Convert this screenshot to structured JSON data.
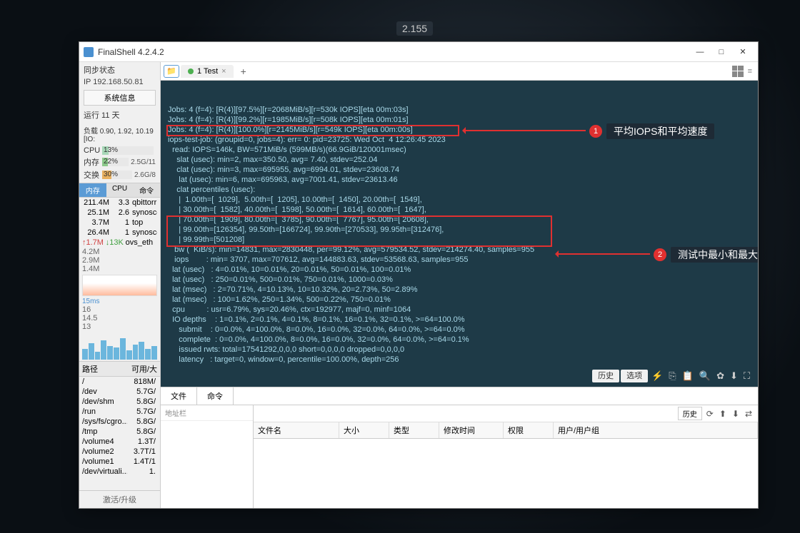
{
  "desktop": {
    "floating_number": "2.155"
  },
  "window": {
    "title": "FinalShell 4.2.4.2"
  },
  "sidebar": {
    "sync_label": "同步状态",
    "ip": "IP 192.168.50.81",
    "sysinfo_btn": "系统信息",
    "uptime": "运行 11 天",
    "load": "负载 0.90, 1.92, 10.19 [IO:",
    "cpu": {
      "label": "CPU",
      "pct": "13%",
      "fill": 13
    },
    "mem": {
      "label": "内存",
      "pct": "22%",
      "right": "2.5G/11",
      "fill": 22,
      "fillColor": "#8bc98b"
    },
    "swap": {
      "label": "交换",
      "pct": "30%",
      "right": "2.6G/8",
      "fill": 30,
      "fillColor": "#e8b060"
    },
    "proc_tabs": [
      "内存",
      "CPU",
      "命令"
    ],
    "procs": [
      {
        "c1": "211.4M",
        "c2": "3.3",
        "c3": "qbittorr"
      },
      {
        "c1": "25.1M",
        "c2": "2.6",
        "c3": "synoscg"
      },
      {
        "c1": "3.7M",
        "c2": "1",
        "c3": "top"
      },
      {
        "c1": "26.4M",
        "c2": "1",
        "c3": "synoscg"
      }
    ],
    "net": {
      "up": "↑1.7M",
      "dn": "↓13K",
      "iface": "ovs_eth"
    },
    "net_nums": [
      "4.2M",
      "2.9M",
      "1.4M"
    ],
    "ping": "15ms",
    "ping_nums": [
      "16",
      "14.5",
      "13"
    ],
    "fs_head": [
      "路径",
      "可用/大"
    ],
    "fs": [
      {
        "p": "/",
        "u": "818M/",
        "pct": 40
      },
      {
        "p": "/dev",
        "u": "5.7G/",
        "pct": 10
      },
      {
        "p": "/dev/shm",
        "u": "5.8G/",
        "pct": 10
      },
      {
        "p": "/run",
        "u": "5.7G/",
        "pct": 10
      },
      {
        "p": "/sys/fs/cgro...",
        "u": "5.8G/",
        "pct": 10
      },
      {
        "p": "/tmp",
        "u": "5.8G/",
        "pct": 10
      },
      {
        "p": "/volume4",
        "u": "1.3T/",
        "pct": 60,
        "warn": true
      },
      {
        "p": "/volume2",
        "u": "3.7T/1",
        "pct": 30
      },
      {
        "p": "/volume1",
        "u": "1.4T/1",
        "pct": 50
      },
      {
        "p": "/dev/virtuali...",
        "u": "1.",
        "pct": 5
      }
    ],
    "upgrade": "激活/升级"
  },
  "tabs": {
    "tab1": "1 Test"
  },
  "terminal_lines": [
    "Jobs: 4 (f=4): [R(4)][97.5%][r=2068MiB/s][r=530k IOPS][eta 00m:03s]",
    "Jobs: 4 (f=4): [R(4)][99.2%][r=1985MiB/s][r=508k IOPS][eta 00m:01s]",
    "Jobs: 4 (f=4): [R(4)][100.0%][r=2145MiB/s][r=549k IOPS][eta 00m:00s]",
    "iops-test-job: (groupid=0, jobs=4): err= 0: pid=23725: Wed Oct  4 12:26:45 2023",
    "  read: IOPS=146k, BW=571MiB/s (599MB/s)(66.9GiB/120001msec)",
    "    slat (usec): min=2, max=350.50, avg= 7.40, stdev=252.04",
    "    clat (usec): min=3, max=695955, avg=6994.01, stdev=23608.74",
    "     lat (usec): min=6, max=695963, avg=7001.41, stdev=23613.46",
    "    clat percentiles (usec):",
    "     |  1.00th=[  1029],  5.00th=[  1205], 10.00th=[  1450], 20.00th=[  1549],",
    "     | 30.00th=[  1582], 40.00th=[  1598], 50.00th=[  1614], 60.00th=[  1647],",
    "     | 70.00th=[  1909], 80.00th=[  3785], 90.00th=[  7767], 95.00th=[ 20608],",
    "     | 99.00th=[126354], 99.50th=[166724], 99.90th=[270533], 99.95th=[312476],",
    "     | 99.99th=[501208]",
    "   bw (  KiB/s): min=14831, max=2830448, per=99.12%, avg=579534.52, stdev=214274.40, samples=955",
    "   iops        : min= 3707, max=707612, avg=144883.63, stdev=53568.63, samples=955",
    "  lat (usec)   : 4=0.01%, 10=0.01%, 20=0.01%, 50=0.01%, 100=0.01%",
    "  lat (usec)   : 250=0.01%, 500=0.01%, 750=0.01%, 1000=0.03%",
    "  lat (msec)   : 2=70.71%, 4=10.13%, 10=10.32%, 20=2.73%, 50=2.89%",
    "  lat (msec)   : 100=1.62%, 250=1.34%, 500=0.22%, 750=0.01%",
    "  cpu          : usr=6.79%, sys=20.46%, ctx=192977, majf=0, minf=1064",
    "  IO depths    : 1=0.1%, 2=0.1%, 4=0.1%, 8=0.1%, 16=0.1%, 32=0.1%, >=64=100.0%",
    "     submit    : 0=0.0%, 4=100.0%, 8=0.0%, 16=0.0%, 32=0.0%, 64=0.0%, >=64=0.0%",
    "     complete  : 0=0.0%, 4=100.0%, 8=0.0%, 16=0.0%, 32=0.0%, 64=0.0%, >=64=0.1%",
    "     issued rwts: total=17541292,0,0,0 short=0,0,0,0 dropped=0,0,0,0",
    "     latency   : target=0, window=0, percentile=100.00%, depth=256"
  ],
  "annotations": {
    "a1": "平均IOPS和平均速度",
    "a2": "测试中最小和最大值"
  },
  "term_toolbar": {
    "history": "历史",
    "options": "选项"
  },
  "lower": {
    "tabs": [
      "文件",
      "命令"
    ],
    "addr_label": "地址栏",
    "file_toolbar": {
      "history": "历史"
    },
    "file_cols": [
      "文件名",
      "大小",
      "类型",
      "修改时间",
      "权限",
      "用户/用户组"
    ]
  }
}
